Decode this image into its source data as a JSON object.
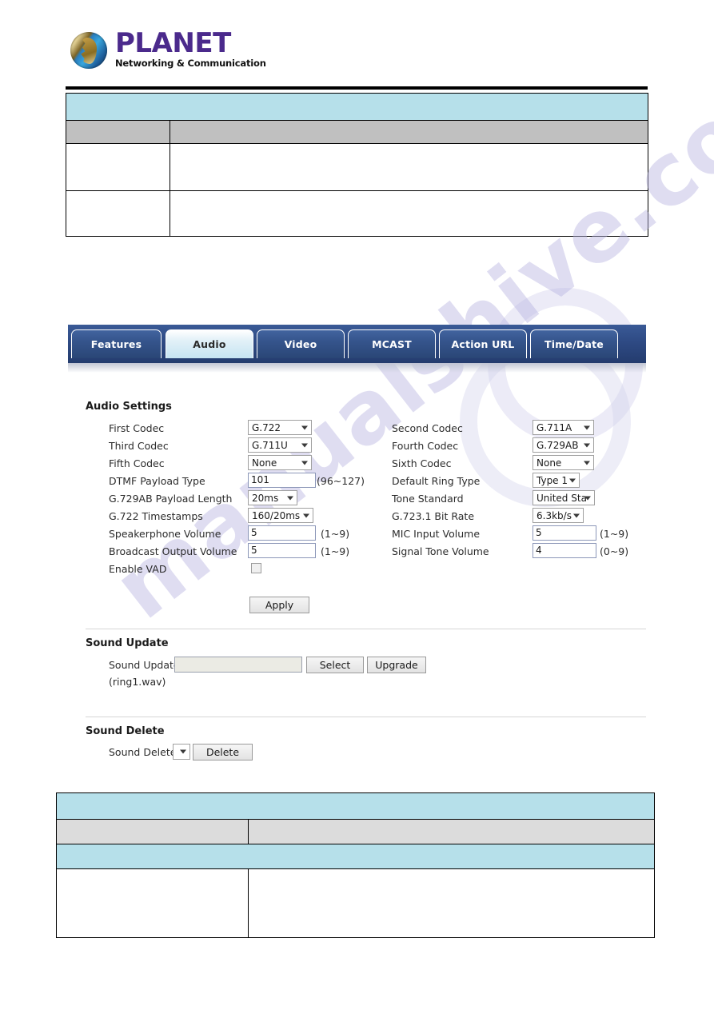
{
  "header": {
    "logo": {
      "icon": "planet-globe-icon",
      "brand": "PLANET",
      "tagline": "Networking & Communication"
    }
  },
  "watermark": {
    "text": "manualshive.com"
  },
  "top_table": {
    "rows": [
      {
        "kind": "title",
        "cells": [
          ""
        ]
      },
      {
        "kind": "subhdr",
        "cells": [
          "",
          ""
        ]
      },
      {
        "kind": "plain",
        "cells": [
          "",
          ""
        ]
      },
      {
        "kind": "plain",
        "cells": [
          "",
          ""
        ]
      }
    ]
  },
  "bottom_table": {
    "rows": [
      {
        "kind": "title",
        "cells": [
          ""
        ]
      },
      {
        "kind": "subhdr2",
        "cells": [
          "",
          ""
        ]
      },
      {
        "kind": "title",
        "cells": [
          ""
        ]
      },
      {
        "kind": "plain",
        "cells": [
          "",
          ""
        ]
      }
    ]
  },
  "tabs": [
    {
      "label": "Features",
      "active": false
    },
    {
      "label": "Audio",
      "active": true
    },
    {
      "label": "Video",
      "active": false
    },
    {
      "label": "MCAST",
      "active": false
    },
    {
      "label": "Action URL",
      "active": false
    },
    {
      "label": "Time/Date",
      "active": false
    }
  ],
  "audio_settings": {
    "title": "Audio Settings",
    "left": [
      {
        "label": "First Codec",
        "control": "select",
        "value": "G.722"
      },
      {
        "label": "Third Codec",
        "control": "select",
        "value": "G.711U"
      },
      {
        "label": "Fifth Codec",
        "control": "select",
        "value": "None"
      },
      {
        "label": "DTMF Payload Type",
        "control": "text",
        "value": "101",
        "hint": "(96~127)"
      },
      {
        "label": "G.729AB Payload Length",
        "control": "select",
        "value": "20ms"
      },
      {
        "label": "G.722 Timestamps",
        "control": "select",
        "value": "160/20ms"
      },
      {
        "label": "Speakerphone Volume",
        "control": "text",
        "value": "5",
        "hint": "(1~9)"
      },
      {
        "label": "Broadcast Output Volume",
        "control": "text",
        "value": "5",
        "hint": "(1~9)"
      },
      {
        "label": "Enable VAD",
        "control": "checkbox",
        "value": "",
        "checked": false
      }
    ],
    "right": [
      {
        "label": "Second Codec",
        "control": "select",
        "value": "G.711A"
      },
      {
        "label": "Fourth Codec",
        "control": "select",
        "value": "G.729AB"
      },
      {
        "label": "Sixth Codec",
        "control": "select",
        "value": "None"
      },
      {
        "label": "Default Ring Type",
        "control": "select",
        "value": "Type 1"
      },
      {
        "label": "Tone Standard",
        "control": "select",
        "value": "United Sta"
      },
      {
        "label": "G.723.1 Bit Rate",
        "control": "select",
        "value": "6.3kb/s"
      },
      {
        "label": "MIC Input Volume",
        "control": "text",
        "value": "5",
        "hint": "(1~9)"
      },
      {
        "label": "Signal Tone Volume",
        "control": "text",
        "value": "4",
        "hint": "(0~9)"
      }
    ],
    "apply_label": "Apply"
  },
  "sound_update": {
    "title": "Sound Update",
    "field_label": "Sound Update",
    "field_value": "",
    "select_label": "Select",
    "upgrade_label": "Upgrade",
    "note": "(ring1.wav)"
  },
  "sound_delete": {
    "title": "Sound Delete",
    "field_label": "Sound Delete",
    "select_value": "",
    "delete_label": "Delete"
  },
  "colors": {
    "tab_blue": "#2e4a84",
    "tab_active": "#c6e4f2",
    "table_title": "#b6e0ea",
    "table_subhdr": "#c0c0c0",
    "table_subhdr2": "#dcdcdc",
    "brand_purple": "#4b2a8c"
  }
}
